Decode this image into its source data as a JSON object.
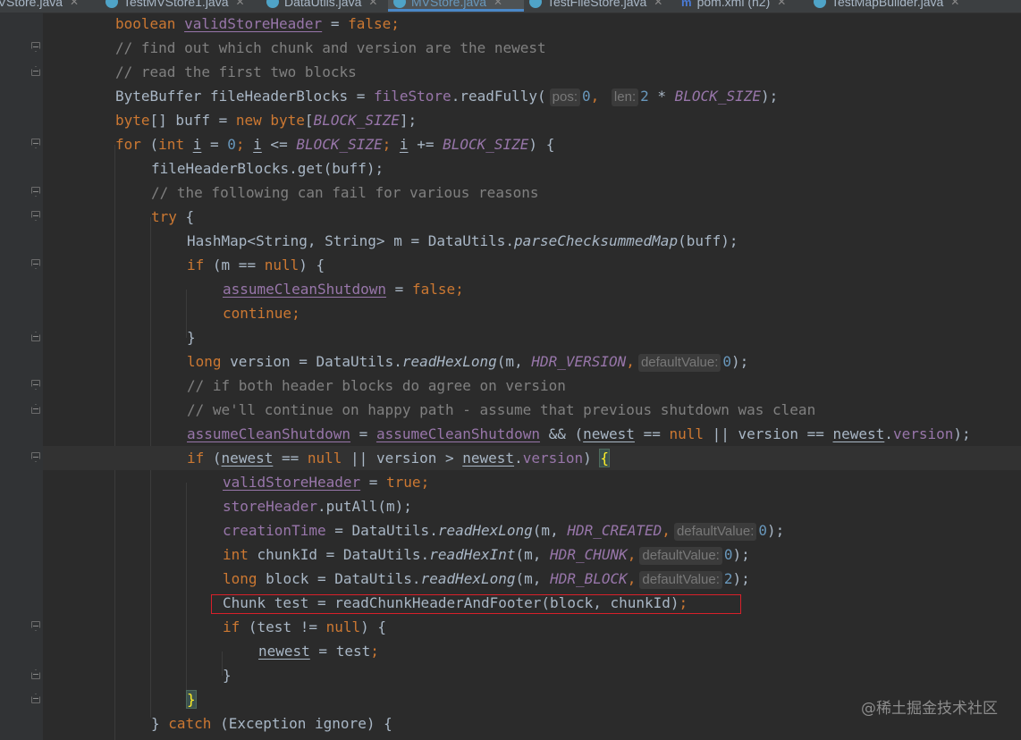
{
  "tabs": [
    {
      "name": "MVStore.java",
      "icon": "java-class-icon",
      "active": false
    },
    {
      "name": "TestMVStore1.java",
      "icon": "java-class-icon",
      "active": false
    },
    {
      "name": "DataUtils.java",
      "icon": "java-class-icon",
      "active": false
    },
    {
      "name": "MVStore.java",
      "icon": "java-class-icon",
      "active": true
    },
    {
      "name": "TestFileStore.java",
      "icon": "java-class-icon",
      "active": false
    },
    {
      "name": "pom.xml (h2)",
      "icon": "maven-icon",
      "active": false
    },
    {
      "name": "TestMapBuilder.java",
      "icon": "java-class-icon",
      "active": false
    }
  ],
  "code": {
    "l01": {
      "t1": "boolean ",
      "t2": "validStoreHeader",
      "t3": " = ",
      "t4": "false",
      "t5": ";"
    },
    "l02": {
      "t1": "// find out which chunk and version are the newest"
    },
    "l03": {
      "t1": "// read the first two blocks"
    },
    "l04": {
      "t1": "ByteBuffer fileHeaderBlocks = ",
      "t2": "fileStore",
      "t3": ".readFully(",
      "h1": "pos:",
      "t4": "0",
      "t5": ", ",
      "h2": "len:",
      "t6": "2",
      "t7": " * ",
      "t8": "BLOCK_SIZE",
      "t9": ");"
    },
    "l05": {
      "t1": "byte",
      "t2": "[] buff = ",
      "t3": "new ",
      "t4": "byte",
      "t5": "[",
      "t6": "BLOCK_SIZE",
      "t7": "];"
    },
    "l06": {
      "t1": "for ",
      "t2": "(",
      "t3": "int ",
      "t4": "i",
      "t5": " = ",
      "t6": "0",
      "t7": "; ",
      "t8": "i",
      "t9": " <= ",
      "t10": "BLOCK_SIZE",
      "t11": "; ",
      "t12": "i",
      "t13": " += ",
      "t14": "BLOCK_SIZE",
      "t15": ") {"
    },
    "l07": {
      "t1": "fileHeaderBlocks.get(buff);"
    },
    "l08": {
      "t1": "// the following can fail for various reasons"
    },
    "l09": {
      "t1": "try",
      "t2": " {"
    },
    "l10": {
      "t1": "HashMap<String, String> m = DataUtils.",
      "t2": "parseChecksummedMap",
      "t3": "(buff);"
    },
    "l11": {
      "t1": "if ",
      "t2": "(m == ",
      "t3": "null",
      "t4": ") {"
    },
    "l12": {
      "t1": "assumeCleanShutdown",
      "t2": " = ",
      "t3": "false",
      "t4": ";"
    },
    "l13": {
      "t1": "continue",
      "t2": ";"
    },
    "l14": {
      "t1": "}"
    },
    "l15": {
      "t1": "long ",
      "t2": "version = DataUtils.",
      "t3": "readHexLong",
      "t4": "(m, ",
      "t5": "HDR_VERSION",
      "t6": ",",
      "h1": "defaultValue:",
      "t7": "0",
      "t8": ");"
    },
    "l16": {
      "t1": "// if both header blocks do agree on version"
    },
    "l17": {
      "t1": "// we'll continue on happy path - assume that previous shutdown was clean"
    },
    "l18": {
      "t1": "assumeCleanShutdown",
      "t2": " = ",
      "t3": "assumeCleanShutdown",
      "t4": " && (",
      "t5": "newest",
      "t6": " == ",
      "t7": "null",
      "t8": " || version == ",
      "t9": "newest",
      "t10": ".",
      "t11": "version",
      "t12": ");"
    },
    "l19": {
      "t1": "if ",
      "t2": "(",
      "t3": "newest",
      "t4": " == ",
      "t5": "null",
      "t6": " || version > ",
      "t7": "newest",
      "t8": ".",
      "t9": "version",
      "t10": ") ",
      "t11": "{"
    },
    "l20": {
      "t1": "validStoreHeader",
      "t2": " = ",
      "t3": "true",
      "t4": ";"
    },
    "l21": {
      "t1": "storeHeader",
      "t2": ".putAll(m);"
    },
    "l22": {
      "t1": "creationTime",
      "t2": " = DataUtils.",
      "t3": "readHexLong",
      "t4": "(m, ",
      "t5": "HDR_CREATED",
      "t6": ",",
      "h1": "defaultValue:",
      "t7": "0",
      "t8": ");"
    },
    "l23": {
      "t1": "int ",
      "t2": "chunkId = DataUtils.",
      "t3": "readHexInt",
      "t4": "(m, ",
      "t5": "HDR_CHUNK",
      "t6": ",",
      "h1": "defaultValue:",
      "t7": "0",
      "t8": ");"
    },
    "l24": {
      "t1": "long ",
      "t2": "block = DataUtils.",
      "t3": "readHexLong",
      "t4": "(m, ",
      "t5": "HDR_BLOCK",
      "t6": ",",
      "h1": "defaultValue:",
      "t7": "2",
      "t8": ");"
    },
    "l25": {
      "t1": "Chunk test = readChunkHeaderAndFooter(block, chunkId)",
      "t2": ";"
    },
    "l26": {
      "t1": "if ",
      "t2": "(test != ",
      "t3": "null",
      "t4": ") {"
    },
    "l27": {
      "t1": "newest",
      "t2": " = test",
      "t3": ";"
    },
    "l28": {
      "t1": "}"
    },
    "l29": {
      "t1": "}"
    },
    "l30": {
      "t1": "} ",
      "t2": "catch ",
      "t3": "(Exception ignore) {"
    }
  },
  "watermark": "@稀土掘金技术社区",
  "colors": {
    "background": "#2b2b2b",
    "keyword": "#cc7832",
    "comment": "#808080",
    "field": "#9876aa",
    "number": "#6897bb",
    "highlight_box": "#d8202a"
  }
}
